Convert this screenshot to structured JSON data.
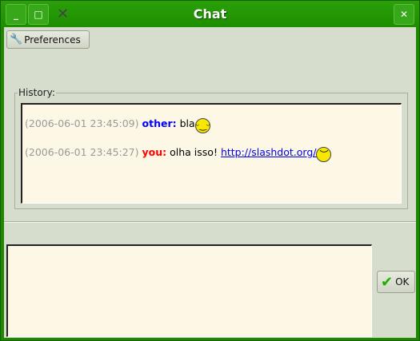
{
  "window": {
    "title": "Chat"
  },
  "toolbar": {
    "preferences_label": "Preferences"
  },
  "history": {
    "label": "History:",
    "messages": [
      {
        "timestamp": "(2006-06-01 23:45:09)",
        "sender": "other:",
        "sender_color": "#0000ff",
        "text": "bla",
        "emoticon": "smile-icon"
      },
      {
        "timestamp": "(2006-06-01 23:45:27)",
        "sender": "you:",
        "sender_color": "#ff0000",
        "text": "olha isso! ",
        "link": "http://slashdot.org/",
        "emoticon": "sad-icon"
      }
    ]
  },
  "input": {
    "value": ""
  },
  "ok_label": "OK"
}
